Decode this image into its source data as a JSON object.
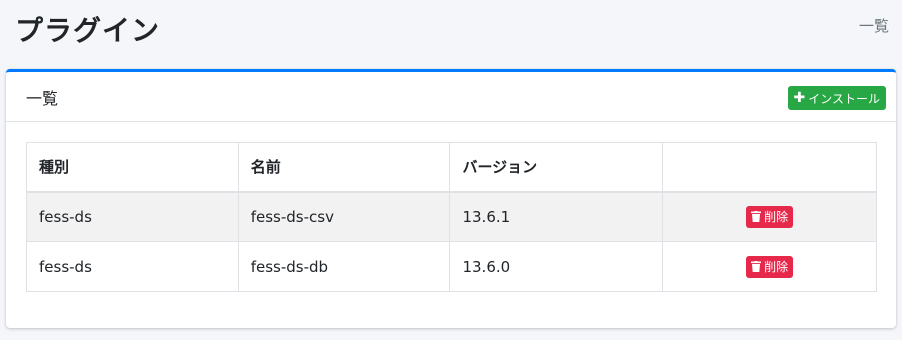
{
  "header": {
    "title": "プラグイン",
    "breadcrumb": "一覧"
  },
  "card": {
    "title": "一覧",
    "install_label": "インストール",
    "install_icon": "plus-icon"
  },
  "table": {
    "columns": [
      "種別",
      "名前",
      "バージョン",
      ""
    ],
    "rows": [
      {
        "type": "fess-ds",
        "name": "fess-ds-csv",
        "version": "13.6.1",
        "action": "削除"
      },
      {
        "type": "fess-ds",
        "name": "fess-ds-db",
        "version": "13.6.0",
        "action": "削除"
      }
    ]
  },
  "colors": {
    "accent": "#007bff",
    "install": "#28a745",
    "delete": "#e6294a"
  }
}
